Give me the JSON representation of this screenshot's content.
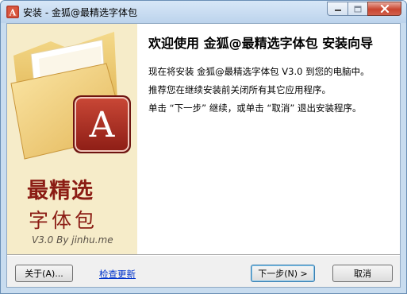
{
  "window": {
    "title": "安装 - 金狐@最精选字体包",
    "app_icon_letter": "A",
    "caption_buttons": [
      "minimize-icon",
      "maximize-icon",
      "close-icon"
    ]
  },
  "sidebar": {
    "tile_letter": "A",
    "brand_line1": "最精选",
    "brand_line2": "字体包",
    "version_text": "V3.0 By jinhu.me",
    "colors": {
      "background": "#f6ecc9",
      "brand": "#8b1c14",
      "tile": "#b02a22"
    }
  },
  "main": {
    "heading": "欢迎使用 金狐@最精选字体包 安装向导",
    "paragraphs": [
      "现在将安装 金狐@最精选字体包 V3.0 到您的电脑中。",
      "推荐您在继续安装前关闭所有其它应用程序。",
      "单击 “下一步” 继续，或单击 “取消” 退出安装程序。"
    ]
  },
  "footer": {
    "about_label": "关于(A)...",
    "update_link": "检查更新",
    "next_label": "下一步(N) >",
    "cancel_label": "取消"
  }
}
